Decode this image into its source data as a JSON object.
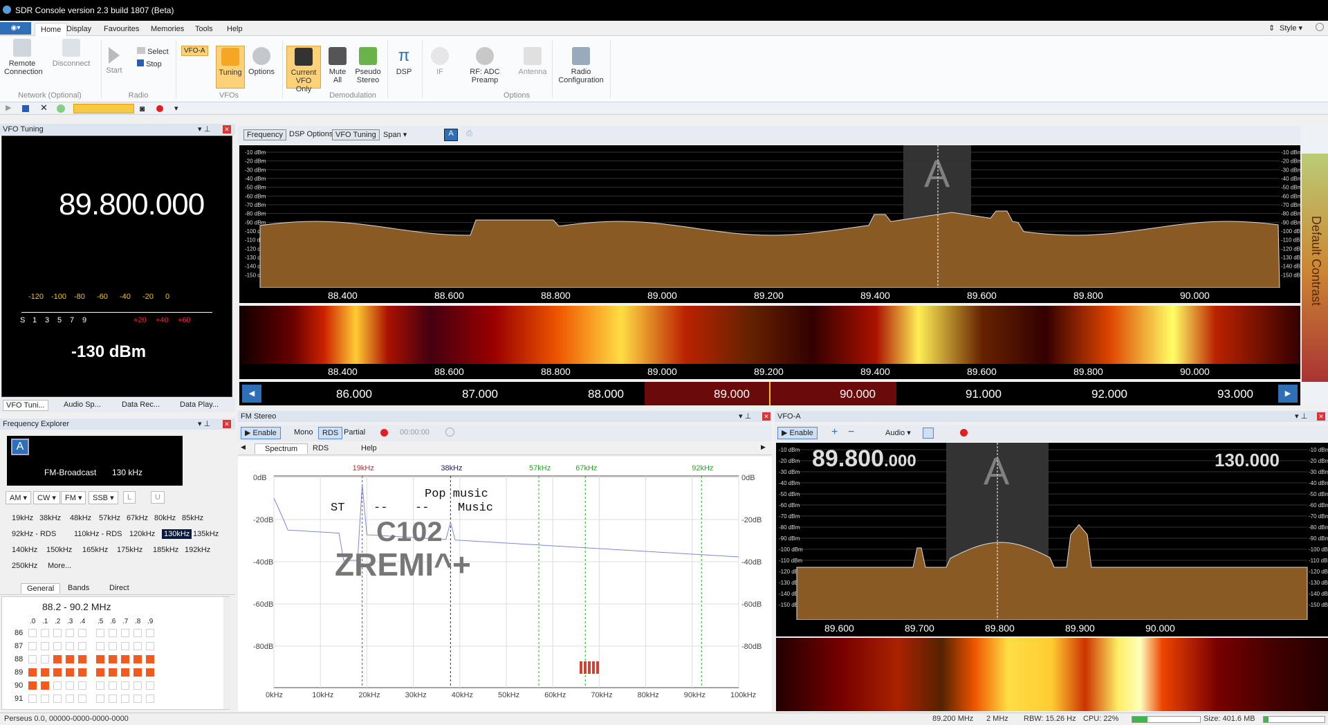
{
  "title": "SDR Console version 2.3 build 1807 (Beta)",
  "menu": [
    "Home",
    "Display",
    "Favourites",
    "Memories",
    "Tools",
    "Help"
  ],
  "style_label": "Style",
  "ribbon": {
    "remote": "Remote\nConnection",
    "disconnect": "Disconnect",
    "start": "Start",
    "select": "Select",
    "stop": "Stop",
    "vfo_badge": "VFO-A",
    "tuning": "Tuning",
    "options": "Options",
    "current_vfo": "Current\nVFO Only",
    "mute_all": "Mute\nAll",
    "pseudo_stereo": "Pseudo\nStereo",
    "dsp": "DSP",
    "if": "IF",
    "rf": "RF: ADC Preamp",
    "antenna": "Antenna",
    "radio_config": "Radio\nConfiguration",
    "groups": {
      "network": "Network (Optional)",
      "radio": "Radio",
      "vfos": "VFOs",
      "demod": "Demodulation",
      "options": "Options"
    }
  },
  "vfo_panel": {
    "title": "VFO Tuning",
    "freq": "89.800.000",
    "dbm": "-130 dBm",
    "scale_top": [
      "-120",
      "-100",
      "-80",
      "-60",
      "-40",
      "-20",
      "0"
    ],
    "scale_s": [
      "S",
      "1",
      "3",
      "5",
      "7",
      "9"
    ],
    "scale_plus": [
      "+20",
      "+40",
      "+60"
    ]
  },
  "left_tabs": [
    "VFO Tuni...",
    "Audio Sp...",
    "Data Rec...",
    "Data Play..."
  ],
  "fe": {
    "title": "Frequency Explorer",
    "badge": "A",
    "name": "FM-Broadcast",
    "bw": "130 kHz",
    "modes": [
      "AM",
      "CW",
      "FM",
      "SSB",
      "L",
      "U"
    ],
    "bws": [
      [
        "19kHz",
        "38kHz",
        "48kHz",
        "57kHz",
        "67kHz",
        "80kHz",
        "85kHz"
      ],
      [
        "92kHz - RDS",
        "110kHz - RDS",
        "120kHz",
        "130kHz",
        "135kHz"
      ],
      [
        "140kHz",
        "150kHz",
        "165kHz",
        "175kHz",
        "185kHz",
        "192kHz"
      ],
      [
        "250kHz",
        "More..."
      ]
    ],
    "tabs": [
      "General",
      "Bands",
      "Direct"
    ],
    "range": "88.2 - 90.2 MHz",
    "cols": [
      ".0",
      ".1",
      ".2",
      ".3",
      ".4",
      ".5",
      ".6",
      ".7",
      ".8",
      ".9"
    ],
    "rows": [
      "86",
      "87",
      "88",
      "89",
      "90",
      "91"
    ]
  },
  "spectrum": {
    "tabs": [
      "Frequency",
      "DSP Options",
      "VFO Tuning",
      "Span"
    ],
    "vfo_letter": "A",
    "contrast": "Default Contrast",
    "dbm": [
      "-10 dBm",
      "-20 dBm",
      "-30 dBm",
      "-40 dBm",
      "-50 dBm",
      "-60 dBm",
      "-70 dBm",
      "-80 dBm",
      "-90 dBm",
      "-100 dBm",
      "-110 dBm",
      "-120 dBm",
      "-130 dBm",
      "-140 dBm",
      "-150 dBm"
    ],
    "freqs": [
      "88.400",
      "88.600",
      "88.800",
      "89.000",
      "89.200",
      "89.400",
      "89.600",
      "89.800",
      "90.000"
    ],
    "band": [
      "86.000",
      "87.000",
      "88.000",
      "89.000",
      "90.000",
      "91.000",
      "92.000",
      "93.000"
    ]
  },
  "fm": {
    "title": "FM Stereo",
    "enable": "Enable",
    "mono": "Mono",
    "rds": "RDS",
    "partial": "Partial",
    "time": "00:00:00",
    "tabs": [
      "Spectrum",
      "RDS",
      "Help"
    ],
    "markers": [
      "19kHz",
      "38kHz",
      "57kHz",
      "67kHz",
      "92kHz"
    ],
    "db": [
      "0dB",
      "-20dB",
      "-40dB",
      "-60dB",
      "-80dB"
    ],
    "xt": [
      "0kHz",
      "10kHz",
      "20kHz",
      "30kHz",
      "40kHz",
      "50kHz",
      "60kHz",
      "70kHz",
      "80kHz",
      "90kHz",
      "100kHz"
    ],
    "pty": "Pop music",
    "st": "ST",
    "dash1": "--",
    "dash2": "--",
    "music": "Music",
    "ps": "C102",
    "rt": "ZREMI^+"
  },
  "vfoa": {
    "title": "VFO-A",
    "enable": "Enable",
    "audio": "Audio",
    "freq_main": "89.800",
    "freq_sub": ".000",
    "bw": "130.000",
    "dbm": [
      "-10 dBm",
      "-20 dBm",
      "-30 dBm",
      "-40 dBm",
      "-50 dBm",
      "-60 dBm",
      "-70 dBm",
      "-80 dBm",
      "-90 dBm",
      "-100 dBm",
      "-110 dBm",
      "-120 dBm",
      "-130 dBm",
      "-140 dBm",
      "-150 dBm"
    ],
    "freqs": [
      "89.600",
      "89.700",
      "89.800",
      "89.900",
      "90.000"
    ]
  },
  "status": {
    "left": "Perseus 0.0, 00000-0000-0000-0000",
    "freq": "89.200 MHz",
    "span": "2 MHz",
    "rbw": "RBW: 15.26 Hz",
    "cpu": "CPU: 22%",
    "cpu_pct": 22,
    "size": "Size: 401.6 MB"
  }
}
